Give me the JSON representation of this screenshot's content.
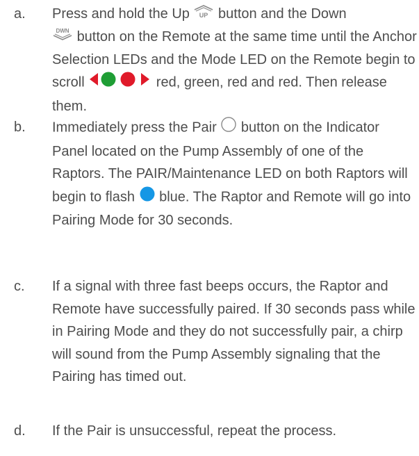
{
  "steps": [
    {
      "marker": "a.",
      "parts": [
        "Press and hold the Up",
        "button and the Down",
        "button on the Remote at the same time until the Anchor Selection LEDs and the Mode LED on the Remote begin to scroll",
        "red, green, red and red. Then release them."
      ],
      "icons": {
        "up_button": {
          "name": "up-button-icon",
          "label": "UP"
        },
        "down_button": {
          "name": "down-button-icon",
          "label": "DWN"
        },
        "led_sequence": {
          "name": "led-scroll-sequence-icon",
          "colors": [
            "#e01a2a",
            "#1f9e35",
            "#e01a2a",
            "#e01a2a"
          ]
        }
      }
    },
    {
      "marker": "b.",
      "parts": [
        "Immediately press the Pair",
        "button on the Indicator Panel located on the Pump Assembly of one of the Raptors. The PAIR/Maintenance LED on both Raptors will begin to flash",
        "blue. The Raptor and Remote will go into Pairing Mode for 30 seconds."
      ],
      "icons": {
        "pair_button": {
          "name": "pair-button-icon"
        },
        "blue_led": {
          "name": "blue-led-icon",
          "color": "#1597e5"
        }
      }
    },
    {
      "marker": "c.",
      "parts": [
        "If a signal with three fast beeps occurs, the Raptor and Remote have successfully paired. If 30 seconds pass while in Pairing Mode and they do not successfully pair, a chirp will sound from the Pump Assembly signaling that the Pairing has timed out."
      ]
    },
    {
      "marker": "d.",
      "parts": [
        "If the Pair is unsuccessful, repeat the process."
      ]
    }
  ],
  "colors": {
    "text": "#4d4d4d",
    "icon_gray": "#8a8a8a",
    "led_red": "#e01a2a",
    "led_green": "#1f9e35",
    "led_blue": "#1597e5"
  }
}
